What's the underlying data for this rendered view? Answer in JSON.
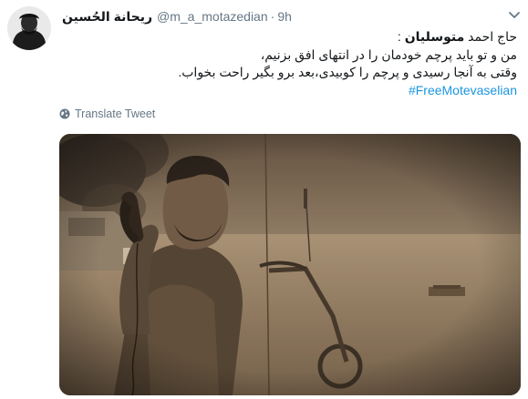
{
  "author": {
    "display_name": "ریحانة الحُسین",
    "handle": "@m_a_motazedian",
    "separator": "·",
    "time": "9h"
  },
  "tweet": {
    "line1_prefix": "حاج احمد ",
    "line1_bold": "متوسلیان",
    "line1_suffix": " :",
    "line2": "من و تو باید پرچم خودمان را در انتهای افق بزنیم،",
    "line3": "وقتی به آنجا رسیدی و پرچم را کوبیدی،بعد برو بگیر راحت بخواب.",
    "hashtag": "#FreeMotevaselian"
  },
  "translate": {
    "label": "Translate Tweet"
  },
  "icons": {
    "menu": "chevron-down-icon",
    "translate": "globe-icon"
  },
  "colors": {
    "link": "#1b95e0",
    "secondary_text": "#657786",
    "primary_text": "#14171a"
  }
}
